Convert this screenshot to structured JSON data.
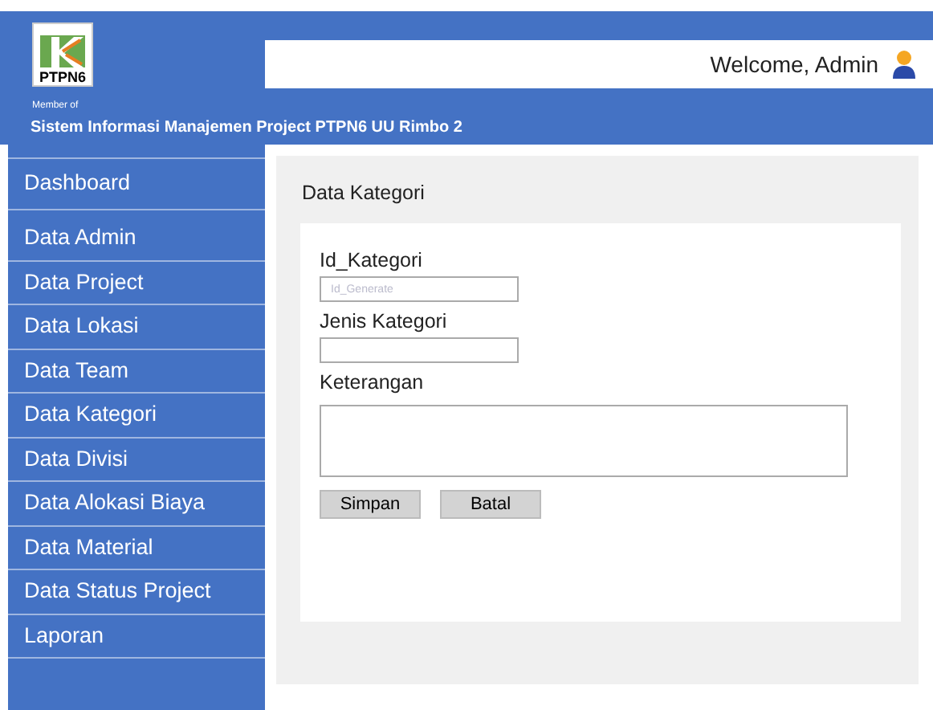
{
  "header": {
    "logo_text": "PTPN6",
    "logo_tagline": "Member of",
    "welcome": "Welcome, Admin",
    "app_title": "Sistem Informasi Manajemen Project PTPN6 UU Rimbo 2"
  },
  "sidebar": {
    "items": [
      {
        "label": "Dashboard"
      },
      {
        "label": "Data Admin"
      },
      {
        "label": "Data Project"
      },
      {
        "label": "Data Lokasi"
      },
      {
        "label": "Data Team"
      },
      {
        "label": "Data Kategori"
      },
      {
        "label": "Data Divisi"
      },
      {
        "label": "Data Alokasi Biaya"
      },
      {
        "label": "Data Material"
      },
      {
        "label": "Data Status Project"
      },
      {
        "label": "Laporan"
      }
    ]
  },
  "form": {
    "title": "Data Kategori",
    "fields": [
      {
        "label": "Id_Kategori",
        "kind": "input",
        "placeholder": "Id_Generate"
      },
      {
        "label": "Jenis Kategori",
        "kind": "input"
      },
      {
        "label": "Keterangan",
        "kind": "textarea"
      }
    ],
    "buttons": [
      "Simpan",
      "Batal"
    ]
  }
}
